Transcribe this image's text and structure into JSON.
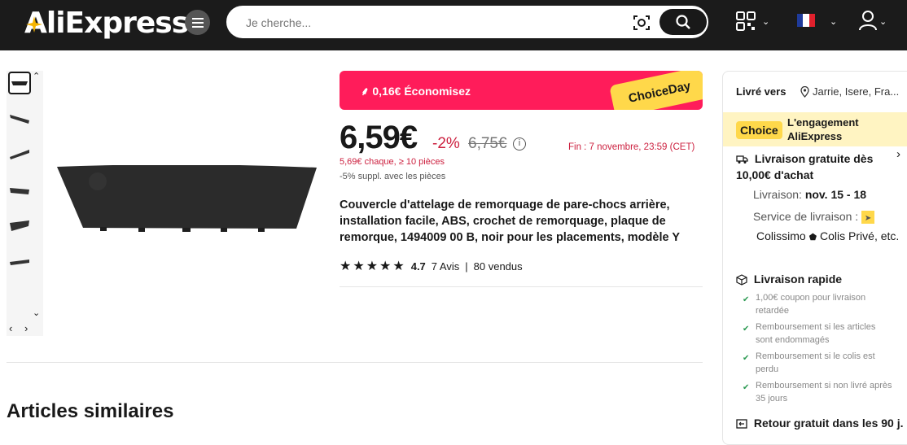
{
  "header": {
    "logo": "AliExpress",
    "search_placeholder": "Je cherche..."
  },
  "product": {
    "promo_text": "0,16€ Économisez",
    "choice_tag": "ChoiceDay",
    "price": "6,59€",
    "discount": "-2%",
    "old_price": "6,75€",
    "info": "i",
    "fin": "Fin :  7 novembre, 23:59 (CET)",
    "bulk": "5,69€ chaque, ≥ 10 pièces",
    "suppl": "-5% suppl. avec les pièces",
    "title": "Couvercle d'attelage de remorquage de pare-chocs arrière, installation facile, ABS, crochet de remorquage, plaque de remorque, 1494009 00 B, noir pour les placements, modèle Y",
    "rating": "4.7",
    "rating_value": 4.7,
    "reviews": "7 Avis",
    "rating_sep": "|",
    "sold": "80 vendus"
  },
  "similar_title": "Articles similaires",
  "panel": {
    "ship_to_label": "Livré vers",
    "ship_to_loc": "Jarrie, Isere, Fra...",
    "choice_badge": "Choice",
    "choice_engagement": "L'engagement AliExpress",
    "free_delivery": "Livraison gratuite dès 10,00€ d'achat",
    "delivery_label": "Livraison:",
    "delivery_date": "nov. 15 - 18",
    "service_label": "Service de livraison :",
    "carrier_1": "Colissimo",
    "carrier_2": "Colis Privé",
    "carrier_etc": ", etc.",
    "fast_title": "Livraison rapide",
    "guarantees": [
      "1,00€ coupon pour livraison retardée",
      "Remboursement si les articles sont endommagés",
      "Remboursement si le colis est perdu",
      "Remboursement si non livré après 35 jours"
    ],
    "free_return": "Retour gratuit dans les 90 j."
  }
}
